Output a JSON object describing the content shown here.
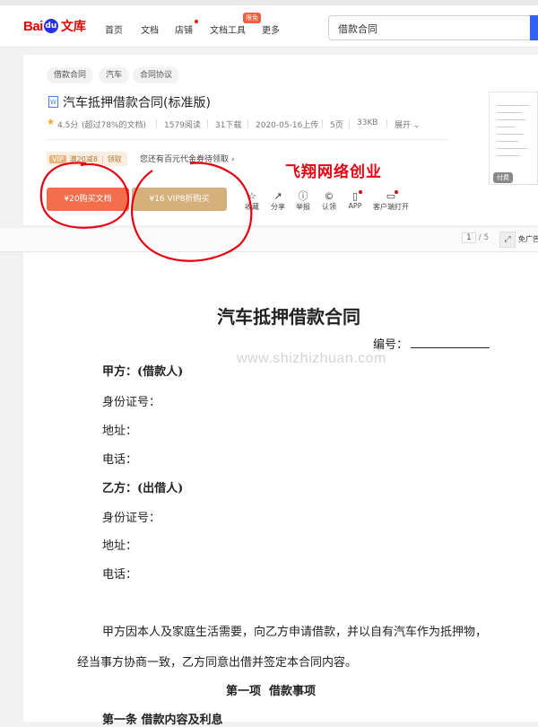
{
  "header": {
    "logo": {
      "bai": "Bai",
      "paw": "du",
      "wenku": "文库"
    },
    "nav": [
      "首页",
      "文档",
      "店铺",
      "文档工具",
      "更多"
    ],
    "new_badge": "限免",
    "search_value": "借款合同"
  },
  "doc_info": {
    "tags": [
      "借款合同",
      "汽车",
      "合同协议"
    ],
    "file_icon": "W",
    "title": "汽车抵押借款合同(标准版)",
    "rating": "4.5分",
    "rating_note": "(超过78%的文档)",
    "reads": "1579阅读",
    "downloads": "31下载",
    "uploaded": "2020-05-16上传",
    "pages": "5页",
    "size": "33KB",
    "expand": "展开"
  },
  "promo": {
    "vip_tag": "VIP",
    "vip_text": "满20减8",
    "vip_get": "领取",
    "coupon_text": "您还有百元代金券待领取 ›"
  },
  "buttons": {
    "buy": "¥20购买文档",
    "vip_buy": "¥16 VIP8折购买"
  },
  "actions": [
    {
      "icon": "star-icon",
      "glyph": "☆",
      "label": "收藏"
    },
    {
      "icon": "share-icon",
      "glyph": "↗",
      "label": "分享"
    },
    {
      "icon": "report-icon",
      "glyph": "ⓘ",
      "label": "举报"
    },
    {
      "icon": "copyright-icon",
      "glyph": "©",
      "label": "认领"
    },
    {
      "icon": "app-icon",
      "glyph": "▯",
      "label": "APP"
    },
    {
      "icon": "monitor-icon",
      "glyph": "▭",
      "label": "客户端打开"
    }
  ],
  "watermark_red": "飞翔网络创业",
  "thumbnail": {
    "paid": "付费"
  },
  "toolbar": {
    "page_current": "1",
    "page_total": "/ 5",
    "free_ad": "免广告"
  },
  "document": {
    "heading": "汽车抵押借款合同",
    "number_label": "编号：",
    "watermark": "www.shizhizhuan.com",
    "party_a": "甲方：(借款人)",
    "id_a": "身份证号：",
    "addr_a": "地址：",
    "tel_a": "电话：",
    "party_b": "乙方：(出借人)",
    "id_b": "身份证号：",
    "addr_b": "地址：",
    "tel_b": "电话：",
    "para1": "甲方因本人及家庭生活需要，向乙方申请借款，并以自有汽车作为抵押物，",
    "para2": "经当事方协商一致，乙方同意出借并签定本合同内容。",
    "section1": "第一项  借款事项",
    "clause1": "第一条 借款内容及利息"
  },
  "colors": {
    "brand_red": "#e10601",
    "buy_orange": "#f46e4c",
    "vip_gold": "#d6b07a",
    "annotation_red": "#e60012"
  }
}
